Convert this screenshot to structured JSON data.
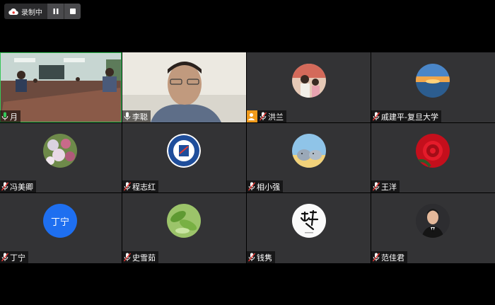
{
  "recording": {
    "label": "录制中"
  },
  "participants": [
    {
      "name": "月",
      "mic": "on",
      "type": "video-room"
    },
    {
      "name": "李聪",
      "mic": "on",
      "type": "video-person"
    },
    {
      "name": "洪兰",
      "mic": "muted",
      "host": true,
      "type": "avatar-photo"
    },
    {
      "name": "戚建平-复旦大学",
      "mic": "muted",
      "type": "avatar-sunset"
    },
    {
      "name": "冯美卿",
      "mic": "muted",
      "type": "avatar-flowers"
    },
    {
      "name": "程志红",
      "mic": "muted",
      "type": "avatar-logo"
    },
    {
      "name": "相小强",
      "mic": "muted",
      "type": "avatar-elephants"
    },
    {
      "name": "王洋",
      "mic": "muted",
      "type": "avatar-rose"
    },
    {
      "name": "丁宁",
      "mic": "muted",
      "type": "avatar-text",
      "avatar_text": "丁宁"
    },
    {
      "name": "史雪茹",
      "mic": "muted",
      "type": "avatar-leaves"
    },
    {
      "name": "钱隽",
      "mic": "muted",
      "type": "avatar-calligraphy"
    },
    {
      "name": "范佳君",
      "mic": "muted",
      "type": "avatar-portrait"
    }
  ],
  "colors": {
    "tile_bg": "#333335",
    "host_badge": "#f09a1b",
    "mic_on": "#34c759",
    "avatar_blue": "#1e6ff0"
  }
}
